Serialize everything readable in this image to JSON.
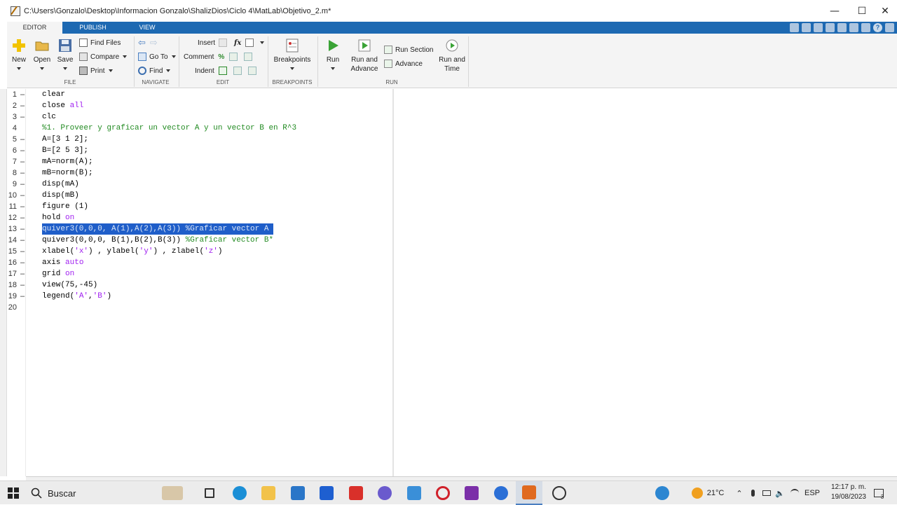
{
  "window": {
    "title": "C:\\Users\\Gonzalo\\Desktop\\Informacion Gonzalo\\ShalizDios\\Ciclo 4\\MatLab\\Objetivo_2.m*"
  },
  "tabs": [
    {
      "label": "EDITOR",
      "active": true
    },
    {
      "label": "PUBLISH",
      "active": false
    },
    {
      "label": "VIEW",
      "active": false
    }
  ],
  "ribbon": {
    "file": {
      "group_label": "FILE",
      "new_label": "New",
      "open_label": "Open",
      "save_label": "Save",
      "find_files_label": "Find Files",
      "compare_label": "Compare",
      "print_label": "Print"
    },
    "navigate": {
      "group_label": "NAVIGATE",
      "goto_label": "Go To",
      "find_label": "Find"
    },
    "edit": {
      "group_label": "EDIT",
      "insert_label": "Insert",
      "comment_label": "Comment",
      "indent_label": "Indent"
    },
    "breakpoints": {
      "group_label": "BREAKPOINTS",
      "breakpoints_label": "Breakpoints"
    },
    "run": {
      "group_label": "RUN",
      "run_label": "Run",
      "run_advance_label_1": "Run and",
      "run_advance_label_2": "Advance",
      "run_section_label": "Run Section",
      "advance_label": "Advance",
      "run_time_label_1": "Run and",
      "run_time_label_2": "Time"
    }
  },
  "editor": {
    "lines": [
      {
        "n": "1",
        "code": "clear"
      },
      {
        "n": "2",
        "code": "close all"
      },
      {
        "n": "3",
        "code": "clc"
      },
      {
        "n": "4",
        "code": "%1. Proveer y graficar un vector A y un vector B en R^3"
      },
      {
        "n": "5",
        "code": "A=[3 1 2];"
      },
      {
        "n": "6",
        "code": "B=[2 5 3];"
      },
      {
        "n": "7",
        "code": "mA=norm(A);"
      },
      {
        "n": "8",
        "code": "mB=norm(B);"
      },
      {
        "n": "9",
        "code": "disp(mA)"
      },
      {
        "n": "10",
        "code": "disp(mB)"
      },
      {
        "n": "11",
        "code": "figure (1)"
      },
      {
        "n": "12",
        "code": "hold on"
      },
      {
        "n": "13",
        "code": "quiver3(0,0,0, A(1),A(2),A(3)) %Graficar vector A "
      },
      {
        "n": "14",
        "code": "quiver3(0,0,0, B(1),B(2),B(3)) %Graficar vector B*"
      },
      {
        "n": "15",
        "code": "xlabel('x') , ylabel('y') , zlabel('z')"
      },
      {
        "n": "16",
        "code": "axis auto"
      },
      {
        "n": "17",
        "code": "grid on"
      },
      {
        "n": "18",
        "code": "view(75,-45)"
      },
      {
        "n": "19",
        "code": "legend('A','B')"
      },
      {
        "n": "20",
        "code": ""
      }
    ],
    "selected_line": "13"
  },
  "taskbar": {
    "search_label": "Buscar",
    "temperature": "21°C",
    "language": "ESP",
    "time": "12:17 p. m.",
    "date": "19/08/2023",
    "notification_count": "3"
  },
  "colors": {
    "tab_strip": "#1d69b2",
    "selection": "#1f5ec9",
    "keyword": "#a020f0",
    "comment": "#228b22"
  }
}
